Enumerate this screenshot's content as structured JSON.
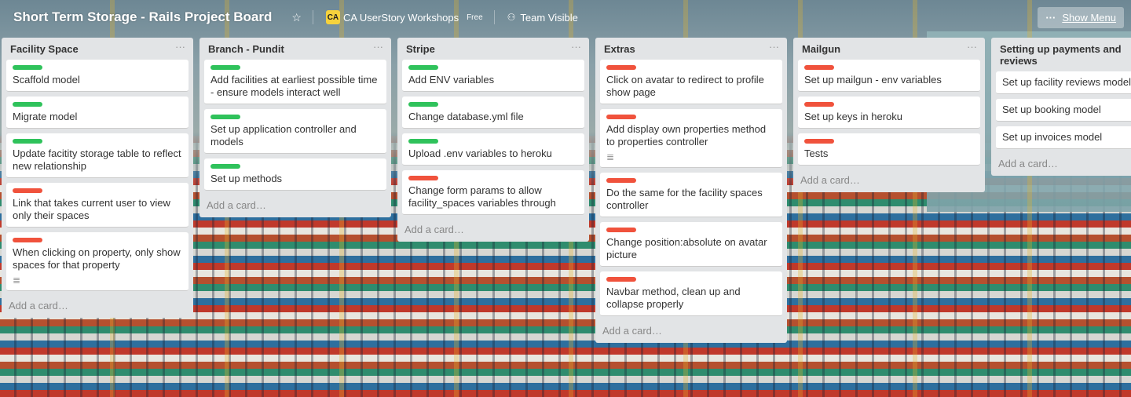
{
  "header": {
    "board_title": "Short Term Storage - Rails Project Board",
    "star_icon": "star-icon",
    "org_logo_text": "CA",
    "org_name": "CA UserStory Workshops",
    "org_badge": "Free",
    "visibility": "Team Visible",
    "menu_dots": "···",
    "show_menu": "Show Menu"
  },
  "lists": [
    {
      "title": "Facility Space",
      "menu": "···",
      "add_card": "Add a card…",
      "cards": [
        {
          "label": "green",
          "text": "Scaffold model",
          "has_desc": false
        },
        {
          "label": "green",
          "text": "Migrate model",
          "has_desc": false
        },
        {
          "label": "green",
          "text": "Update facitity storage table to reflect new relationship",
          "has_desc": false
        },
        {
          "label": "red",
          "text": "Link that takes current user to view only their spaces",
          "has_desc": false
        },
        {
          "label": "red",
          "text": "When clicking on property, only show spaces for that property",
          "has_desc": true
        }
      ]
    },
    {
      "title": "Branch - Pundit",
      "menu": "···",
      "add_card": "Add a card…",
      "cards": [
        {
          "label": "green",
          "text": "Add facilities at earliest possible time - ensure models interact well",
          "has_desc": false
        },
        {
          "label": "green",
          "text": "Set up application controller and models",
          "has_desc": false
        },
        {
          "label": "green",
          "text": "Set up methods",
          "has_desc": false
        }
      ]
    },
    {
      "title": "Stripe",
      "menu": "···",
      "add_card": "Add a card…",
      "cards": [
        {
          "label": "green",
          "text": "Add ENV variables",
          "has_desc": false
        },
        {
          "label": "green",
          "text": "Change database.yml file",
          "has_desc": false
        },
        {
          "label": "green",
          "text": "Upload .env variables to heroku",
          "has_desc": false
        },
        {
          "label": "red",
          "text": "Change form params to allow facility_spaces variables through",
          "has_desc": false
        }
      ]
    },
    {
      "title": "Extras",
      "menu": "···",
      "add_card": "Add a card…",
      "cards": [
        {
          "label": "red",
          "text": "Click on avatar to redirect to profile show page",
          "has_desc": false
        },
        {
          "label": "red",
          "text": "Add display own properties method to properties controller",
          "has_desc": true
        },
        {
          "label": "red",
          "text": "Do the same for the facility spaces controller",
          "has_desc": false
        },
        {
          "label": "red",
          "text": "Change position:absolute on avatar picture",
          "has_desc": false
        },
        {
          "label": "red",
          "text": "Navbar method, clean up and collapse properly",
          "has_desc": false
        }
      ]
    },
    {
      "title": "Mailgun",
      "menu": "···",
      "add_card": "Add a card…",
      "cards": [
        {
          "label": "red",
          "text": "Set up mailgun - env variables",
          "has_desc": false
        },
        {
          "label": "red",
          "text": "Set up keys in heroku",
          "has_desc": false
        },
        {
          "label": "red",
          "text": "Tests",
          "has_desc": false
        }
      ]
    },
    {
      "title": "Setting up payments and reviews",
      "menu": "",
      "add_card": "Add a card…",
      "cards": [
        {
          "label": "",
          "text": "Set up facility reviews model",
          "has_desc": false
        },
        {
          "label": "",
          "text": "Set up booking model",
          "has_desc": false
        },
        {
          "label": "",
          "text": "Set up invoices model",
          "has_desc": false
        }
      ]
    }
  ],
  "colors": {
    "label_green": "#2fc25b",
    "label_red": "#f0523c",
    "list_bg": "#e2e4e6"
  }
}
